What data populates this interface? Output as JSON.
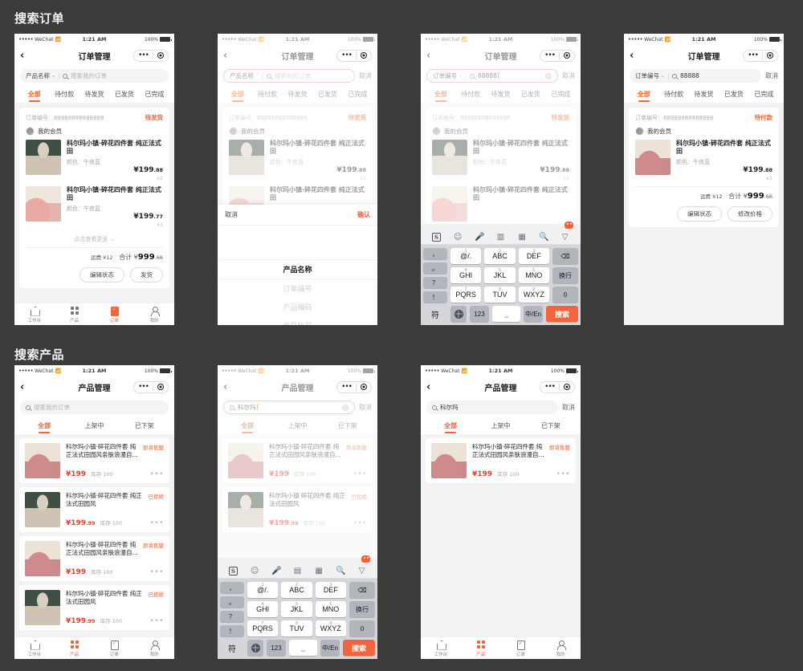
{
  "sections": [
    {
      "title": "搜索订单"
    },
    {
      "title": "搜索产品"
    }
  ],
  "status_bar": {
    "carrier_dots": "•••••",
    "carrier": "WeChat",
    "wifi": "wifi-icon",
    "time": "1:21 AM",
    "battery_pct": "100%"
  },
  "order_screen": {
    "nav": {
      "back": "‹",
      "title": "订单管理",
      "more_dots": "•••",
      "target": "target-icon"
    },
    "search": {
      "selector_default": "产品名称",
      "selector_order_no": "订单编号",
      "placeholder": "搜索我的订单",
      "value_88888": "88888",
      "cancel": "取消",
      "clear": "×"
    },
    "tabs": [
      {
        "label": "全部",
        "active": true
      },
      {
        "label": "待付款",
        "active": false
      },
      {
        "label": "待发货",
        "active": false
      },
      {
        "label": "已发货",
        "active": false
      },
      {
        "label": "已完成",
        "active": false
      }
    ],
    "card": {
      "order_no_label": "订单编号：",
      "order_no": "88888888888888",
      "status_pending_ship": "待发货",
      "status_pending_pay": "待付款",
      "member_name": "我的会员",
      "items": [
        {
          "title": "科尔玛小镇·碎花四件套 纯正法式田",
          "attr": "颜色：午夜蓝",
          "price_int": "¥199",
          "price_dec": ".88",
          "qty": "x1",
          "thumb": "green"
        },
        {
          "title": "科尔玛小镇·碎花四件套 纯正法式田",
          "attr": "颜色：午夜蓝",
          "price_int": "¥199",
          "price_dec": ".77",
          "qty": "x1",
          "thumb": "pink"
        }
      ],
      "item_single": {
        "title": "科尔玛小镇·碎花四件套 纯正法式田",
        "attr": "颜色：午夜蓝",
        "price_int": "¥199",
        "price_dec": ".88",
        "qty": "x1",
        "thumb": "rose"
      },
      "more_link": "点击查看更多 ⌄",
      "shipping_label": "运费 ¥12",
      "total_label": "合计 ¥",
      "total_int": "999",
      "total_dec": ".66",
      "buttons": {
        "edit_status": "编辑状态",
        "ship": "发货",
        "modify_price": "修改价格"
      }
    }
  },
  "picker": {
    "cancel": "取消",
    "confirm": "确认",
    "options": [
      {
        "label": "产品名称",
        "selected": true
      },
      {
        "label": "订单编号",
        "selected": false
      },
      {
        "label": "产品编码",
        "selected": false
      },
      {
        "label": "会员帐号",
        "selected": false
      }
    ]
  },
  "product_screen": {
    "nav": {
      "back": "‹",
      "title": "产品管理",
      "more_dots": "•••",
      "target": "target-icon"
    },
    "search": {
      "placeholder": "搜索我的订单",
      "value": "科尔玛",
      "cancel": "取消",
      "clear": "×"
    },
    "tabs": [
      {
        "label": "全部",
        "active": true
      },
      {
        "label": "上架中",
        "active": false
      },
      {
        "label": "已下架",
        "active": false
      }
    ],
    "items": [
      {
        "title": "科尔玛小镇·碎花四件套 纯正法式田园风亲肤浪漫自...",
        "badge": "即将售罄",
        "price_int": "¥199",
        "price_dec": "",
        "stock": "库存 100",
        "dots": "•••",
        "thumb": "rose"
      },
      {
        "title": "科尔玛小镇·碎花四件套 纯正法式田园风",
        "badge": "已拒绝",
        "price_int": "¥199",
        "price_dec": ".99",
        "stock": "库存 100",
        "dots": "•••",
        "thumb": "green"
      },
      {
        "title": "科尔玛小镇·碎花四件套 纯正法式田园风亲肤浪漫自...",
        "badge": "即将售罄",
        "price_int": "¥199",
        "price_dec": "",
        "stock": "库存 100",
        "dots": "•••",
        "thumb": "rose"
      },
      {
        "title": "科尔玛小镇·碎花四件套 纯正法式田园风",
        "badge": "已拒绝",
        "price_int": "¥199",
        "price_dec": ".99",
        "stock": "库存 100",
        "dots": "•••",
        "thumb": "green"
      }
    ],
    "result_item": {
      "title": "科尔玛小镇·碎花四件套 纯正法式田园风亲肤浪漫自...",
      "badge": "即将售罄",
      "price_int": "¥199",
      "stock": "库存 100",
      "dots": "•••",
      "thumb": "rose"
    }
  },
  "bottom_nav": [
    {
      "label": "工作台",
      "icon": "home-icon",
      "active": false
    },
    {
      "label": "产品",
      "icon": "grid-icon",
      "active": false
    },
    {
      "label": "订单",
      "icon": "clipboard-icon",
      "active": true
    },
    {
      "label": "我的",
      "icon": "user-icon",
      "active": false
    }
  ],
  "bottom_nav_product": [
    {
      "label": "工作台",
      "icon": "home-icon",
      "active": false
    },
    {
      "label": "产品",
      "icon": "grid-icon",
      "active": true
    },
    {
      "label": "订单",
      "icon": "clipboard-icon",
      "active": false
    },
    {
      "label": "我的",
      "icon": "user-icon",
      "active": false
    }
  ],
  "keyboard": {
    "toolbar_icons": [
      "sogou-logo",
      "emoji-icon",
      "mic-icon",
      "handwriting-icon",
      "grid-icon",
      "search-icon",
      "collapse-icon"
    ],
    "sogou_glyph": "S",
    "punct_keys": [
      "，",
      "。",
      "？",
      "！"
    ],
    "rows": [
      [
        {
          "sup": "1",
          "label": "@/."
        },
        {
          "sup": "2",
          "label": "ABC"
        },
        {
          "sup": "3",
          "label": "DEF"
        }
      ],
      [
        {
          "sup": "4",
          "label": "GHI"
        },
        {
          "sup": "5",
          "label": "JKL"
        },
        {
          "sup": "6",
          "label": "MNO"
        }
      ],
      [
        {
          "sup": "7",
          "label": "PQRS"
        },
        {
          "sup": "8",
          "label": "TUV"
        },
        {
          "sup": "9",
          "label": "WXYZ"
        }
      ]
    ],
    "right_keys": [
      "⌫",
      "换行",
      "0"
    ],
    "bottom": {
      "sym": "符",
      "globe": "globe-icon",
      "num": "123",
      "space": "space-icon",
      "cn": "中/En",
      "search": "搜索"
    }
  },
  "colors": {
    "accent": "#f2653a",
    "price_red": "#e8402a",
    "page_bg": "#3b3b3b",
    "app_bg": "#f3f3f3"
  }
}
